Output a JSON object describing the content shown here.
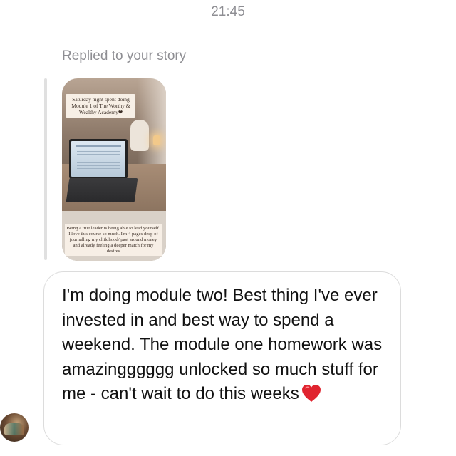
{
  "header": {
    "timestamp": "21:45"
  },
  "reply": {
    "label": "Replied to your story"
  },
  "story": {
    "top_caption": "Saturday night spent doing Module 1 of The Worthy & Wealthy Academy❤",
    "bottom_caption": "Being a true leader is being able to lead yourself. I love this course so much. I'm 4 pages deep of journalling my childhood/ past around money and already feeling a deeper match for my desires"
  },
  "message": {
    "text": "I'm doing module two! Best thing I've ever invested in and best way to spend a weekend. The module one homework was amazingggggg unlocked so much stuff for me - can't wait to do this weeks",
    "emoji": "red-heart-icon",
    "colors": {
      "bubble_border": "#dcdcdc",
      "heart": "#e0242f"
    }
  },
  "sender": {
    "avatar": "avatar"
  }
}
